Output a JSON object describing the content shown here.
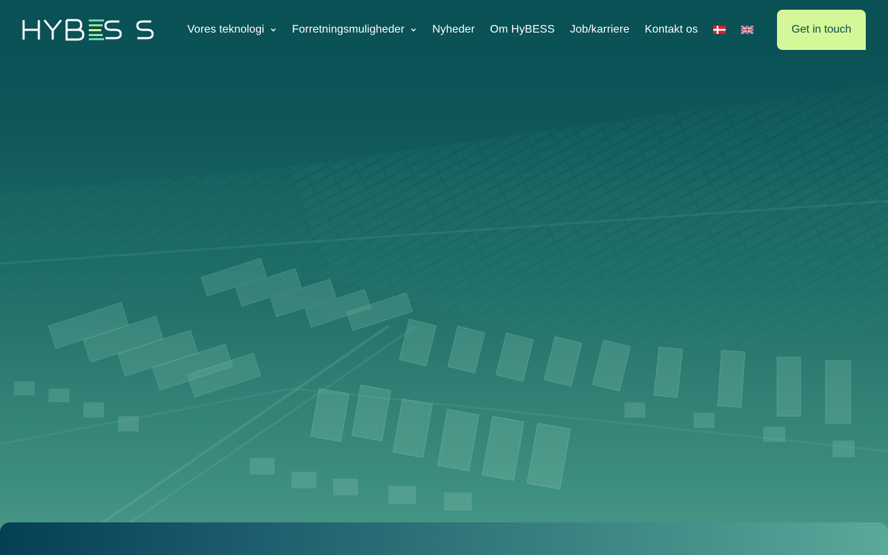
{
  "brand": {
    "name": "HYBESS"
  },
  "nav": {
    "items": [
      {
        "label": "Vores teknologi",
        "has_dropdown": true
      },
      {
        "label": "Forretningsmuligheder",
        "has_dropdown": true
      },
      {
        "label": "Nyheder",
        "has_dropdown": false
      },
      {
        "label": "Om HyBESS",
        "has_dropdown": false
      },
      {
        "label": "Job/karriere",
        "has_dropdown": false
      },
      {
        "label": "Kontakt os",
        "has_dropdown": false
      }
    ],
    "languages": [
      {
        "code": "da",
        "icon": "danish-flag-icon"
      },
      {
        "code": "en",
        "icon": "uk-flag-icon"
      }
    ]
  },
  "cta": {
    "label": "Get in touch"
  },
  "colors": {
    "accent": "#d4f898",
    "header_bg": "#0a5156",
    "text": "#ffffff",
    "cta_text": "#0b4a4e"
  },
  "hero": {
    "image": "aerial-battery-storage-and-solar-park"
  }
}
